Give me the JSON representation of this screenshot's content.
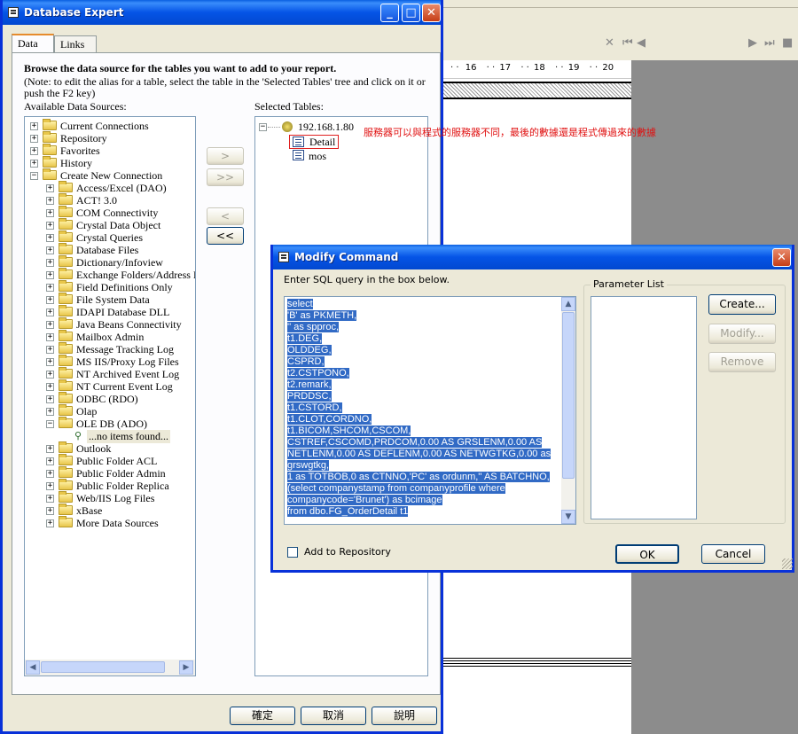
{
  "background": {
    "ruler_labels": [
      "16",
      "17",
      "18",
      "19",
      "20"
    ]
  },
  "db_expert": {
    "title": "Database Expert",
    "tabs": [
      "Data",
      "Links"
    ],
    "heading": "Browse the data source for the tables you want to add to your report.",
    "note": "(Note: to edit the alias for a table, select the table in the 'Selected Tables' tree and click on it or push the F2 key)",
    "available_label": "Available Data Sources:",
    "selected_label": "Selected Tables:",
    "tree_top": [
      "Current Connections",
      "Repository",
      "Favorites",
      "History",
      "Create New Connection"
    ],
    "tree_children": [
      "Access/Excel (DAO)",
      "ACT! 3.0",
      "COM Connectivity",
      "Crystal Data Object",
      "Crystal Queries",
      "Database Files",
      "Dictionary/Infoview",
      "Exchange Folders/Address B",
      "Field Definitions Only",
      "File System Data",
      "IDAPI Database DLL",
      "Java Beans Connectivity",
      "Mailbox Admin",
      "Message Tracking Log",
      "MS IIS/Proxy Log Files",
      "NT Archived Event Log",
      "NT Current Event Log",
      "ODBC (RDO)",
      "Olap",
      "OLE DB (ADO)"
    ],
    "oledb_child": "...no items found...",
    "tree_after": [
      "Outlook",
      "Public Folder ACL",
      "Public Folder Admin",
      "Public Folder Replica",
      "Web/IIS Log Files",
      "xBase",
      "More Data Sources"
    ],
    "transfer_buttons": [
      ">",
      ">>",
      "<",
      "<<"
    ],
    "selected_server": "192.168.1.80",
    "selected_tables": [
      "Detail",
      "mos"
    ],
    "annotation": "服務器可以與程式的服務器不同，最後的數據還是程式傳過來的數據",
    "footer_buttons": [
      "確定",
      "取消",
      "說明"
    ]
  },
  "modify_command": {
    "title": "Modify Command",
    "instruction": "Enter SQL query in the box below.",
    "sql_lines": [
      "select",
      "'B' as PKMETH,",
      "'' as spproc,",
      "t1.DEG,",
      "OLDDEG,",
      "CSPRD,",
      "t2.CSTPONO,",
      "t2.remark,",
      "PRDDSC,",
      "t1.CSTORD,",
      "t1.CLOT,CORDNO,",
      "t1.BICOM,SHCOM,CSCOM,",
      "CSTREF,CSCOMD,PRDCOM,0.00 AS GRSLENM,0.00 AS",
      "NETLENM,0.00 AS DEFLENM,0.00 AS NETWGTKG,0.00 as",
      "grswgtkg,",
      "1 as TOTBOB,0 as CTNNO,'PC' as ordunm,'' AS BATCHNO,",
      "(select companystamp from companyprofile where",
      "companycode='Brunet') as bcimage",
      "from dbo.FG_OrderDetail t1"
    ],
    "parameter_list_label": "Parameter List",
    "param_buttons": [
      "Create...",
      "Modify...",
      "Remove"
    ],
    "add_to_repository": "Add to Repository",
    "add_to_repository_checked": false,
    "ok": "OK",
    "cancel": "Cancel"
  }
}
